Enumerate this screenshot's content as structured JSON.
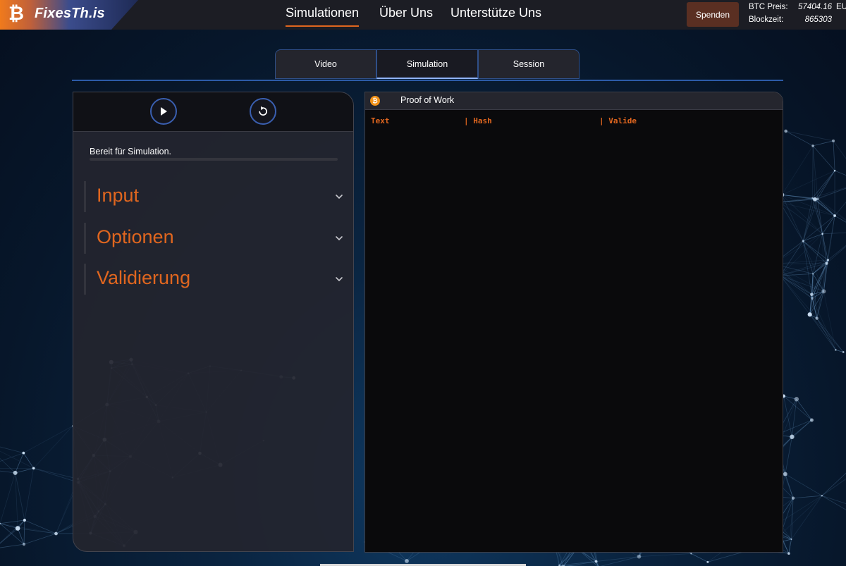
{
  "brand": {
    "logo_text": "FixesTh.is",
    "logo_glyph": "₿",
    "accent_color": "#e0661f",
    "bitcoin_color": "#f2931a"
  },
  "nav": {
    "links": [
      {
        "label": "Simulationen",
        "active": true
      },
      {
        "label": "Über Uns",
        "active": false
      },
      {
        "label": "Unterstütze Uns",
        "active": false
      }
    ],
    "donate_label": "Spenden",
    "btc_price_label": "BTC Preis:",
    "btc_price_value": "57404.16",
    "btc_price_unit": "EU",
    "block_time_label": "Blockzeit:",
    "block_time_value": "865303"
  },
  "tabs": [
    {
      "label": "Video",
      "active": false
    },
    {
      "label": "Simulation",
      "active": true
    },
    {
      "label": "Session",
      "active": false
    }
  ],
  "controls": {
    "play_icon": "play-icon",
    "reset_icon": "reset-icon",
    "status_text": "Bereit für Simulation.",
    "progress_percent": 0
  },
  "accordion": [
    {
      "title": "Input"
    },
    {
      "title": "Optionen"
    },
    {
      "title": "Validierung"
    }
  ],
  "output": {
    "title": "Proof of Work",
    "columns": [
      "Text",
      "| Hash",
      "| Valide"
    ]
  }
}
